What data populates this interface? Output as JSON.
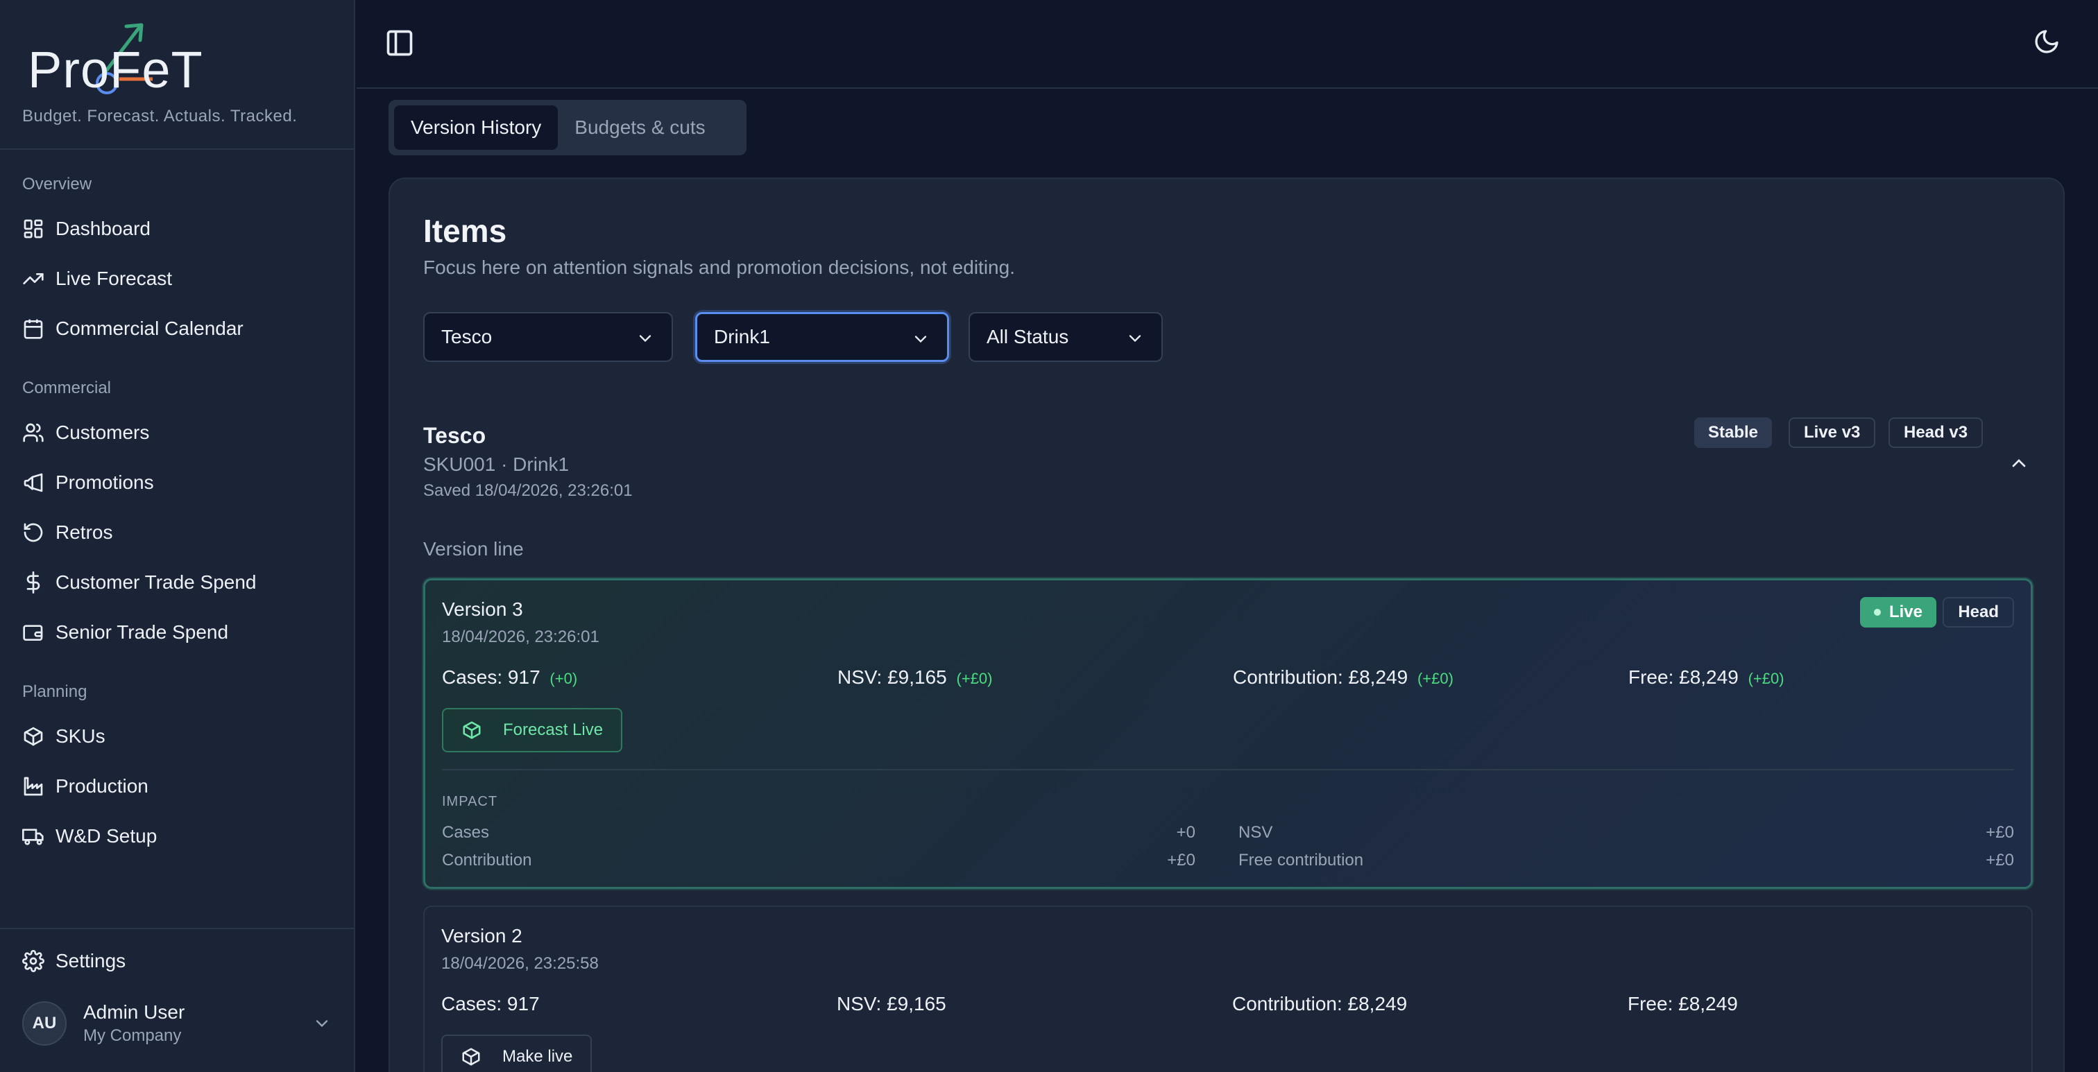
{
  "brand": {
    "logo_text": "ProFeT",
    "tagline": "Budget. Forecast. Actuals. Tracked."
  },
  "sidebar": {
    "sections": [
      {
        "label": "Overview",
        "items": [
          {
            "label": "Dashboard",
            "icon": "dashboard-icon"
          },
          {
            "label": "Live Forecast",
            "icon": "trending-up-icon"
          },
          {
            "label": "Commercial Calendar",
            "icon": "calendar-icon"
          }
        ]
      },
      {
        "label": "Commercial",
        "items": [
          {
            "label": "Customers",
            "icon": "users-icon"
          },
          {
            "label": "Promotions",
            "icon": "megaphone-icon"
          },
          {
            "label": "Retros",
            "icon": "rotate-icon"
          },
          {
            "label": "Customer Trade Spend",
            "icon": "dollar-icon"
          },
          {
            "label": "Senior Trade Spend",
            "icon": "wallet-icon"
          }
        ]
      },
      {
        "label": "Planning",
        "items": [
          {
            "label": "SKUs",
            "icon": "package-icon"
          },
          {
            "label": "Production",
            "icon": "factory-icon"
          },
          {
            "label": "W&D Setup",
            "icon": "truck-icon"
          }
        ]
      }
    ],
    "settings_label": "Settings",
    "user": {
      "initials": "AU",
      "name": "Admin User",
      "company": "My Company"
    }
  },
  "tabs": [
    {
      "label": "Version History",
      "active": true
    },
    {
      "label": "Budgets & cuts",
      "active": false
    }
  ],
  "main": {
    "title": "Items",
    "subtitle": "Focus here on attention signals and promotion decisions, not editing.",
    "filters": {
      "customer": "Tesco",
      "product": "Drink1",
      "status": "All Status"
    },
    "group": {
      "name": "Tesco",
      "sku_line": "SKU001 · Drink1",
      "saved": "Saved 18/04/2026, 23:26:01",
      "badges": {
        "stable": "Stable",
        "live": "Live v3",
        "head": "Head v3"
      }
    },
    "version_line_label": "Version line",
    "versions": [
      {
        "title": "Version 3",
        "date": "18/04/2026, 23:26:01",
        "live_badge": "Live",
        "head_badge": "Head",
        "cases": "Cases: 917",
        "cases_delta": "(+0)",
        "nsv": "NSV: £9,165",
        "nsv_delta": "(+£0)",
        "contribution": "Contribution: £8,249",
        "contribution_delta": "(+£0)",
        "free": "Free: £8,249",
        "free_delta": "(+£0)",
        "action_label": "Forecast Live",
        "impact": {
          "label": "IMPACT",
          "cases_label": "Cases",
          "cases_value": "+0",
          "nsv_label": "NSV",
          "nsv_value": "+£0",
          "contribution_label": "Contribution",
          "contribution_value": "+£0",
          "free_label": "Free contribution",
          "free_value": "+£0"
        }
      },
      {
        "title": "Version 2",
        "date": "18/04/2026, 23:25:58",
        "cases": "Cases: 917",
        "nsv": "NSV: £9,165",
        "contribution": "Contribution: £8,249",
        "free": "Free: £8,249",
        "action_label": "Make live"
      }
    ]
  },
  "colors": {
    "background": "#0f1629",
    "sidebar": "#1a2436",
    "accent_green": "#3aa57a",
    "delta_green": "#4ade80",
    "focus_blue": "#5b8def"
  }
}
